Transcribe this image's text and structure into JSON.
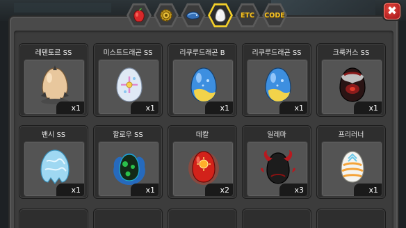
{
  "tabs": [
    {
      "id": "fruit",
      "icon": "red-fruit-icon",
      "label": ""
    },
    {
      "id": "gear",
      "icon": "gold-gear-icon",
      "label": ""
    },
    {
      "id": "fish",
      "icon": "blue-fish-icon",
      "label": ""
    },
    {
      "id": "egg",
      "icon": "egg-icon",
      "label": "",
      "active": true
    },
    {
      "id": "etc",
      "icon": "",
      "label": "ETC"
    },
    {
      "id": "code",
      "icon": "",
      "label": "CODE"
    }
  ],
  "close_label": "✖",
  "items": [
    {
      "name": "레텐토르 SS",
      "qty": "x1",
      "egg": "spiky-tan"
    },
    {
      "name": "미스트드래곤 SS",
      "qty": "x1",
      "egg": "white-cross"
    },
    {
      "name": "리쿠루드래곤 B",
      "qty": "x1",
      "egg": "blue-spotted"
    },
    {
      "name": "리쿠루드래곤 SS",
      "qty": "x1",
      "egg": "blue-spotted"
    },
    {
      "name": "크룩커스 SS",
      "qty": "x1",
      "egg": "dark-red"
    },
    {
      "name": "밴시 SS",
      "qty": "x1",
      "egg": "ice-blue"
    },
    {
      "name": "할로우 SS",
      "qty": "x1",
      "egg": "shadow-flame"
    },
    {
      "name": "데칼",
      "qty": "x2",
      "egg": "red-sun"
    },
    {
      "name": "일레마",
      "qty": "x3",
      "egg": "horned-black"
    },
    {
      "name": "프리러너",
      "qty": "x1",
      "egg": "striped-white"
    }
  ],
  "colors": {
    "active_tab": "#f3cf2a",
    "tab_text": "#f4c226",
    "close_red": "#c8221e"
  }
}
